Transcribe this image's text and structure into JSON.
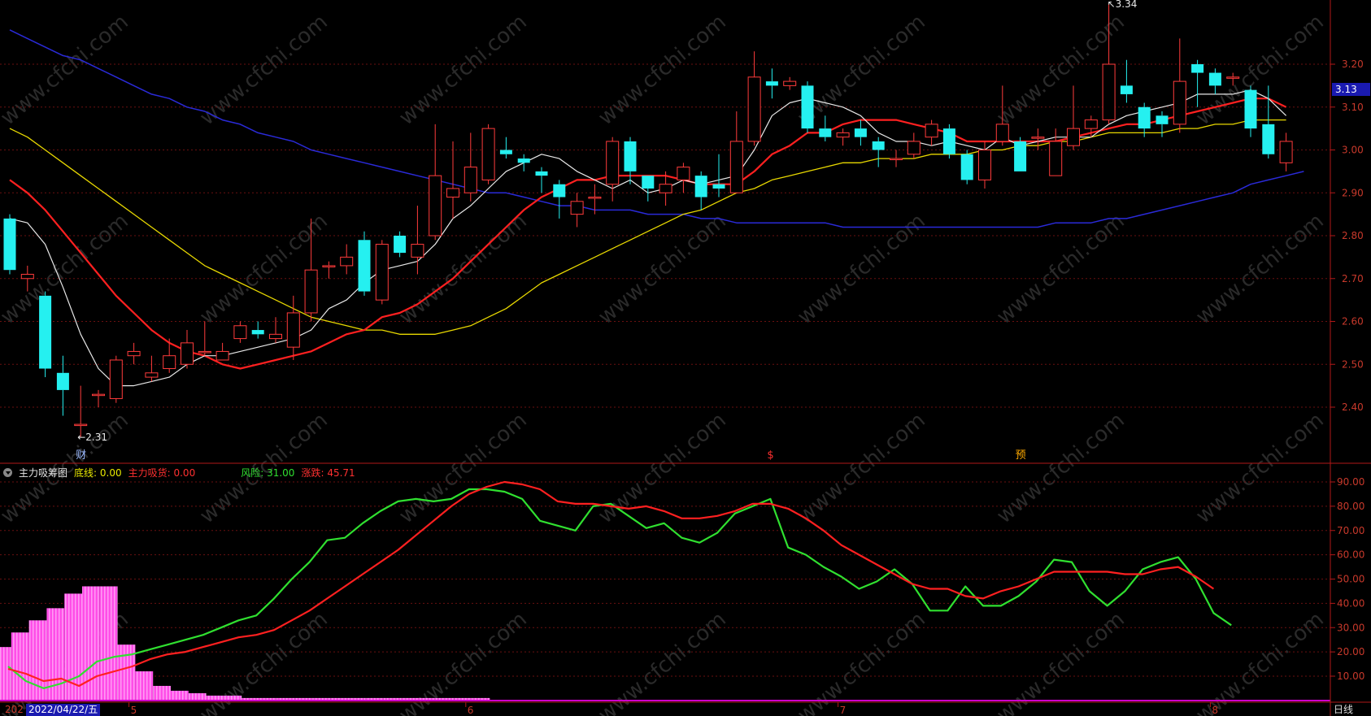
{
  "main_chart": {
    "type": "candlestick",
    "ylim": [
      2.31,
      3.36
    ],
    "yticks": [
      "3.20",
      "3.10",
      "3.00",
      "2.90",
      "2.80",
      "2.70",
      "2.60",
      "2.50",
      "2.40"
    ],
    "high_label": "3.34",
    "low_label": "2.31",
    "current_price": "3.13",
    "colors": {
      "up": "#ff3b3b",
      "down": "#25f0f0",
      "ma5": "#e8e8e8",
      "ma10": "#ff2020",
      "ma20": "#e8d800",
      "ma60": "#2a2ad8"
    },
    "candles": [
      [
        2.84,
        2.72,
        2.85,
        2.71
      ],
      [
        2.7,
        2.71,
        2.73,
        2.67
      ],
      [
        2.66,
        2.49,
        2.67,
        2.47
      ],
      [
        2.48,
        2.44,
        2.52,
        2.38
      ],
      [
        2.36,
        2.36,
        2.45,
        2.33
      ],
      [
        2.43,
        2.43,
        2.44,
        2.4
      ],
      [
        2.42,
        2.51,
        2.52,
        2.41
      ],
      [
        2.52,
        2.53,
        2.55,
        2.5
      ],
      [
        2.47,
        2.48,
        2.52,
        2.46
      ],
      [
        2.49,
        2.52,
        2.56,
        2.48
      ],
      [
        2.5,
        2.55,
        2.58,
        2.49
      ],
      [
        2.53,
        2.53,
        2.6,
        2.52
      ],
      [
        2.51,
        2.53,
        2.55,
        2.51
      ],
      [
        2.56,
        2.59,
        2.6,
        2.55
      ],
      [
        2.58,
        2.57,
        2.6,
        2.56
      ],
      [
        2.56,
        2.57,
        2.61,
        2.55
      ],
      [
        2.54,
        2.62,
        2.66,
        2.51
      ],
      [
        2.62,
        2.72,
        2.84,
        2.6
      ],
      [
        2.73,
        2.73,
        2.74,
        2.7
      ],
      [
        2.73,
        2.75,
        2.78,
        2.71
      ],
      [
        2.79,
        2.67,
        2.81,
        2.66
      ],
      [
        2.65,
        2.78,
        2.79,
        2.64
      ],
      [
        2.8,
        2.76,
        2.81,
        2.75
      ],
      [
        2.75,
        2.78,
        2.87,
        2.71
      ],
      [
        2.8,
        2.94,
        3.06,
        2.79
      ],
      [
        2.89,
        2.91,
        3.02,
        2.84
      ],
      [
        2.9,
        2.96,
        3.04,
        2.88
      ],
      [
        2.93,
        3.05,
        3.06,
        2.92
      ],
      [
        3.0,
        2.99,
        3.03,
        2.98
      ],
      [
        2.98,
        2.97,
        2.99,
        2.95
      ],
      [
        2.95,
        2.94,
        2.96,
        2.9
      ],
      [
        2.92,
        2.89,
        2.93,
        2.84
      ],
      [
        2.85,
        2.88,
        2.9,
        2.82
      ],
      [
        2.89,
        2.89,
        2.92,
        2.85
      ],
      [
        2.92,
        3.02,
        3.03,
        2.88
      ],
      [
        3.02,
        2.95,
        3.03,
        2.92
      ],
      [
        2.94,
        2.91,
        2.94,
        2.88
      ],
      [
        2.9,
        2.92,
        2.95,
        2.87
      ],
      [
        2.93,
        2.96,
        2.97,
        2.9
      ],
      [
        2.94,
        2.89,
        2.95,
        2.86
      ],
      [
        2.92,
        2.91,
        2.99,
        2.89
      ],
      [
        2.9,
        3.02,
        3.09,
        2.9
      ],
      [
        3.02,
        3.17,
        3.23,
        3.01
      ],
      [
        3.16,
        3.15,
        3.19,
        3.12
      ],
      [
        3.15,
        3.16,
        3.17,
        3.14
      ],
      [
        3.15,
        3.05,
        3.16,
        3.04
      ],
      [
        3.05,
        3.03,
        3.08,
        3.02
      ],
      [
        3.03,
        3.04,
        3.05,
        3.01
      ],
      [
        3.05,
        3.03,
        3.07,
        3.01
      ],
      [
        3.02,
        3.0,
        3.03,
        2.96
      ],
      [
        2.98,
        2.98,
        3.0,
        2.96
      ],
      [
        2.99,
        3.02,
        3.04,
        2.98
      ],
      [
        3.03,
        3.06,
        3.07,
        3.01
      ],
      [
        3.05,
        2.99,
        3.06,
        2.98
      ],
      [
        2.99,
        2.93,
        3.0,
        2.92
      ],
      [
        2.93,
        3.0,
        3.02,
        2.91
      ],
      [
        3.02,
        3.06,
        3.15,
        3.01
      ],
      [
        3.02,
        2.95,
        3.03,
        2.95
      ],
      [
        3.03,
        3.03,
        3.05,
        3.0
      ],
      [
        2.94,
        3.02,
        3.05,
        2.94
      ],
      [
        3.01,
        3.05,
        3.15,
        3.0
      ],
      [
        3.05,
        3.07,
        3.08,
        3.03
      ],
      [
        3.07,
        3.2,
        3.34,
        3.06
      ],
      [
        3.15,
        3.13,
        3.21,
        3.11
      ],
      [
        3.1,
        3.05,
        3.11,
        3.03
      ],
      [
        3.08,
        3.06,
        3.09,
        3.03
      ],
      [
        3.06,
        3.16,
        3.26,
        3.04
      ],
      [
        3.2,
        3.18,
        3.21,
        3.1
      ],
      [
        3.18,
        3.15,
        3.19,
        3.13
      ],
      [
        3.17,
        3.17,
        3.18,
        3.15
      ],
      [
        3.14,
        3.05,
        3.15,
        3.03
      ],
      [
        3.06,
        2.99,
        3.15,
        2.98
      ],
      [
        2.97,
        3.02,
        3.04,
        2.95
      ]
    ],
    "ma5": [
      2.84,
      2.83,
      2.78,
      2.68,
      2.57,
      2.49,
      2.45,
      2.45,
      2.46,
      2.47,
      2.5,
      2.52,
      2.52,
      2.53,
      2.54,
      2.55,
      2.56,
      2.58,
      2.63,
      2.65,
      2.69,
      2.72,
      2.73,
      2.74,
      2.78,
      2.84,
      2.87,
      2.91,
      2.95,
      2.97,
      2.99,
      2.98,
      2.95,
      2.93,
      2.91,
      2.93,
      2.9,
      2.91,
      2.93,
      2.92,
      2.93,
      2.94,
      3.0,
      3.08,
      3.11,
      3.12,
      3.11,
      3.1,
      3.08,
      3.04,
      3.02,
      3.02,
      3.01,
      3.02,
      3.01,
      3.0,
      3.03,
      3.01,
      3.02,
      3.03,
      3.03,
      3.03,
      3.06,
      3.08,
      3.09,
      3.1,
      3.11,
      3.13,
      3.13,
      3.13,
      3.14,
      3.12,
      3.08
    ],
    "ma10": [
      2.93,
      2.9,
      2.86,
      2.81,
      2.76,
      2.71,
      2.66,
      2.62,
      2.58,
      2.55,
      2.53,
      2.52,
      2.5,
      2.49,
      2.5,
      2.51,
      2.52,
      2.53,
      2.55,
      2.57,
      2.58,
      2.61,
      2.62,
      2.64,
      2.67,
      2.7,
      2.74,
      2.78,
      2.82,
      2.86,
      2.89,
      2.91,
      2.93,
      2.93,
      2.94,
      2.94,
      2.94,
      2.94,
      2.93,
      2.92,
      2.92,
      2.92,
      2.95,
      2.99,
      3.01,
      3.04,
      3.04,
      3.06,
      3.07,
      3.07,
      3.07,
      3.06,
      3.05,
      3.04,
      3.02,
      3.02,
      3.02,
      3.02,
      3.02,
      3.02,
      3.03,
      3.04,
      3.05,
      3.06,
      3.06,
      3.07,
      3.08,
      3.09,
      3.1,
      3.11,
      3.12,
      3.12,
      3.1
    ],
    "ma20": [
      3.05,
      3.03,
      3.0,
      2.97,
      2.94,
      2.91,
      2.88,
      2.85,
      2.82,
      2.79,
      2.76,
      2.73,
      2.71,
      2.69,
      2.67,
      2.65,
      2.63,
      2.61,
      2.6,
      2.59,
      2.58,
      2.58,
      2.57,
      2.57,
      2.57,
      2.58,
      2.59,
      2.61,
      2.63,
      2.66,
      2.69,
      2.71,
      2.73,
      2.75,
      2.77,
      2.79,
      2.81,
      2.83,
      2.85,
      2.86,
      2.88,
      2.9,
      2.91,
      2.93,
      2.94,
      2.95,
      2.96,
      2.97,
      2.97,
      2.98,
      2.98,
      2.98,
      2.99,
      2.99,
      2.99,
      3.0,
      3.0,
      3.01,
      3.01,
      3.02,
      3.02,
      3.03,
      3.04,
      3.04,
      3.04,
      3.04,
      3.05,
      3.05,
      3.06,
      3.06,
      3.07,
      3.07,
      3.07
    ],
    "ma60": [
      3.28,
      3.26,
      3.24,
      3.22,
      3.21,
      3.19,
      3.17,
      3.15,
      3.13,
      3.12,
      3.1,
      3.09,
      3.07,
      3.06,
      3.04,
      3.03,
      3.02,
      3.0,
      2.99,
      2.98,
      2.97,
      2.96,
      2.95,
      2.94,
      2.93,
      2.92,
      2.91,
      2.9,
      2.9,
      2.89,
      2.88,
      2.87,
      2.87,
      2.86,
      2.86,
      2.86,
      2.85,
      2.85,
      2.85,
      2.84,
      2.84,
      2.83,
      2.83,
      2.83,
      2.83,
      2.83,
      2.83,
      2.82,
      2.82,
      2.82,
      2.82,
      2.82,
      2.82,
      2.82,
      2.82,
      2.82,
      2.82,
      2.82,
      2.82,
      2.83,
      2.83,
      2.83,
      2.84,
      2.84,
      2.85,
      2.86,
      2.87,
      2.88,
      2.89,
      2.9,
      2.92,
      2.93,
      2.94,
      2.95
    ],
    "markers": [
      {
        "index": 4,
        "text": "财",
        "color": "#9ab8ff"
      },
      {
        "index": 43,
        "text": "$",
        "color": "#ff3030"
      },
      {
        "index": 57,
        "text": "预",
        "color": "#ffaa00"
      }
    ]
  },
  "indicator": {
    "name": "主力吸筹图",
    "ylim": [
      0,
      95
    ],
    "yticks": [
      "90.00",
      "80.00",
      "70.00",
      "60.00",
      "50.00",
      "40.00",
      "30.00",
      "20.00",
      "10.00"
    ],
    "legend": [
      {
        "label": "底线:",
        "value": "0.00",
        "color": "#e8e800"
      },
      {
        "label": "主力吸货:",
        "value": "0.00",
        "color": "#ff3030"
      },
      {
        "label": "风险:",
        "value": "31.00",
        "color": "#30e030"
      },
      {
        "label": "涨跌:",
        "value": "45.71",
        "color": "#ff3030"
      }
    ],
    "risk": [
      14,
      8,
      5,
      7,
      10,
      16,
      18,
      19,
      21,
      23,
      25,
      27,
      30,
      33,
      35,
      42,
      50,
      57,
      66,
      67,
      73,
      78,
      82,
      83,
      82,
      83,
      87,
      87,
      86,
      83,
      74,
      72,
      70,
      80,
      81,
      76,
      71,
      73,
      67,
      65,
      69,
      77,
      80,
      83,
      63,
      60,
      55,
      51,
      46,
      49,
      54,
      48,
      37,
      37,
      47,
      39,
      39,
      43,
      49,
      58,
      57,
      45,
      39,
      45,
      54,
      57,
      59,
      50,
      36,
      31
    ],
    "trend": [
      13,
      11,
      8,
      9,
      6,
      10,
      12,
      14,
      17,
      19,
      20,
      22,
      24,
      26,
      27,
      29,
      33,
      37,
      42,
      47,
      52,
      57,
      62,
      68,
      74,
      80,
      85,
      88,
      90,
      89,
      87,
      82,
      81,
      81,
      80,
      79,
      80,
      78,
      75,
      75,
      76,
      78,
      81,
      81,
      79,
      75,
      70,
      64,
      60,
      56,
      52,
      48,
      46,
      46,
      43,
      42,
      45,
      47,
      50,
      53,
      53,
      53,
      53,
      52,
      52,
      54,
      55,
      51,
      46
    ],
    "bars": [
      22,
      28,
      33,
      38,
      44,
      47,
      47,
      23,
      12,
      6,
      4,
      3,
      2,
      2,
      1,
      1,
      1,
      1,
      1,
      1,
      1,
      1,
      1,
      1,
      1,
      1,
      1,
      1,
      0
    ]
  },
  "x_axis": {
    "month_ticks": [
      {
        "index": 7,
        "label": "5"
      },
      {
        "index": 26,
        "label": "6"
      },
      {
        "index": 47,
        "label": "7"
      },
      {
        "index": 68,
        "label": "8"
      }
    ],
    "left_label": "202",
    "cursor_date": "2022/04/22/五",
    "period": "日线"
  },
  "watermark": "www.cfchi.com"
}
